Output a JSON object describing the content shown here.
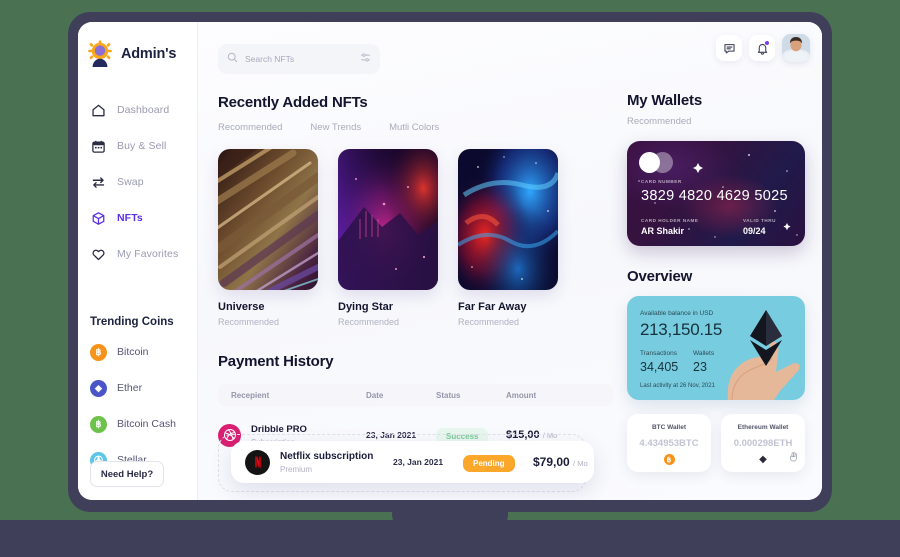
{
  "theme": {
    "page_bg": "#4a7252",
    "device_bezel": "#403f5a",
    "accent_purple": "#5b2fe8",
    "accent_orange": "#faa72c",
    "success_green": "#7ec99a",
    "overview_blue": "#78ccdf"
  },
  "sidebar": {
    "brand": {
      "name": "Admin's",
      "logo_icon": "sun-avatar-logo"
    },
    "items": [
      {
        "label": "Dashboard",
        "icon": "home-icon",
        "active": false
      },
      {
        "label": "Buy & Sell",
        "icon": "calendar-icon",
        "active": false
      },
      {
        "label": "Swap",
        "icon": "swap-arrows-icon",
        "active": false
      },
      {
        "label": "NFTs",
        "icon": "cube-icon",
        "active": true
      },
      {
        "label": "My Favorites",
        "icon": "heart-icon",
        "active": false
      }
    ],
    "trending_title": "Trending Coins",
    "coins": [
      {
        "label": "Bitcoin",
        "symbol": "B",
        "color": "#f7931a",
        "icon": "bitcoin-icon"
      },
      {
        "label": "Ether",
        "symbol": "E",
        "color": "#4a55c8",
        "icon": "ether-icon"
      },
      {
        "label": "Bitcoin Cash",
        "symbol": "B",
        "color": "#6cc24a",
        "icon": "bitcoin-cash-icon"
      },
      {
        "label": "Stellar",
        "symbol": "S",
        "color": "#5bc6e8",
        "icon": "stellar-icon"
      }
    ],
    "help_label": "Need Help?"
  },
  "topbar": {
    "search_placeholder": "Search NFTs",
    "search_value": "",
    "icons": [
      "search-icon",
      "filter-sliders-icon",
      "message-icon",
      "bell-icon",
      "avatar"
    ]
  },
  "nfts": {
    "title": "Recently Added NFTs",
    "tabs": [
      {
        "label": "Recommended"
      },
      {
        "label": "New Trends"
      },
      {
        "label": "Mutli Colors"
      }
    ],
    "cards": [
      {
        "name": "Universe",
        "sub": "Recommended",
        "art": "brown-gold-feathers"
      },
      {
        "name": "Dying Star",
        "sub": "Recommended",
        "art": "magenta-purple-nebula"
      },
      {
        "name": "Far Far Away",
        "sub": "Recommended",
        "art": "blue-red-nebula"
      }
    ]
  },
  "payments": {
    "title": "Payment History",
    "columns": [
      "Recepient",
      "Date",
      "Status",
      "Amount"
    ],
    "rows": [
      {
        "name": "Dribble PRO",
        "type": "Subscription",
        "date": "23, Jan 2021",
        "status": "Success",
        "status_kind": "success",
        "amount": "$15,00",
        "period": "/ Mo",
        "avatar_icon": "dribbble-icon",
        "avatar_color": "#d91f72",
        "highlighted": false
      },
      {
        "name": "Netflix subscription",
        "type": "Premium",
        "date": "23, Jan 2021",
        "status": "Pending",
        "status_kind": "pending",
        "amount": "$79,00",
        "period": "/ Mo",
        "avatar_icon": "netflix-icon",
        "avatar_color": "#1b1b1b",
        "highlighted": true
      }
    ]
  },
  "wallets": {
    "title": "My Wallets",
    "subtitle": "Recommended",
    "card": {
      "number_label": "CARD NUMBER",
      "number": "3829 4820 4629 5025",
      "holder_label": "CARD HOLDER NAME",
      "holder": "AR Shakir",
      "valid_label": "VALID THRU",
      "valid": "09/24"
    }
  },
  "overview": {
    "title": "Overview",
    "balance_label": "Available balance in USD",
    "balance": "213,150.15",
    "transactions_label": "Transactions",
    "transactions": "34,405",
    "wallets_label": "Wallets",
    "wallets": "23",
    "last_activity": "Last activity at 26 Nov, 2021",
    "graphic_icon": "ethereum-diamond-icon"
  },
  "small_wallets": [
    {
      "title": "BTC Wallet",
      "value": "4.434953",
      "unit": "BTC",
      "icon": "bitcoin-icon",
      "color": "#f7931a"
    },
    {
      "title": "Ethereum Wallet",
      "value": "0.000298",
      "unit": "ETH",
      "icon": "ethereum-icon",
      "color": "#2b2b38"
    }
  ]
}
